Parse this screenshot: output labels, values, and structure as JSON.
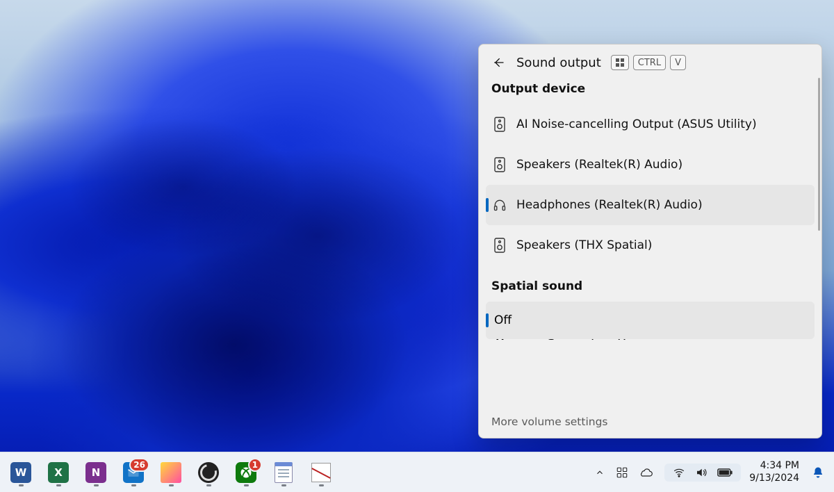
{
  "flyout": {
    "title": "Sound output",
    "shortcut_keys": [
      "WIN",
      "CTRL",
      "V"
    ],
    "section_output": "Output device",
    "devices": [
      {
        "label": "AI Noise-cancelling Output (ASUS Utility)",
        "icon": "speaker",
        "selected": false
      },
      {
        "label": "Speakers (Realtek(R) Audio)",
        "icon": "speaker",
        "selected": false
      },
      {
        "label": "Headphones (Realtek(R) Audio)",
        "icon": "headphones",
        "selected": true
      },
      {
        "label": "Speakers (THX Spatial)",
        "icon": "speaker",
        "selected": false
      }
    ],
    "section_spatial": "Spatial sound",
    "spatial_options": [
      {
        "label": "Off",
        "selected": true
      },
      {
        "label": "Windows Sonic for Headphones",
        "selected": false
      }
    ],
    "more_link": "More volume settings"
  },
  "taskbar": {
    "apps": [
      {
        "name": "word",
        "letter": "W",
        "badge": null
      },
      {
        "name": "excel",
        "letter": "X",
        "badge": null
      },
      {
        "name": "onenote",
        "letter": "N",
        "badge": null
      },
      {
        "name": "outlook",
        "letter": "",
        "badge": "26"
      },
      {
        "name": "sticky-notes",
        "letter": "",
        "badge": null
      },
      {
        "name": "obs",
        "letter": "",
        "badge": null
      },
      {
        "name": "xbox",
        "letter": "",
        "badge": "1"
      },
      {
        "name": "notepad",
        "letter": "",
        "badge": null
      },
      {
        "name": "snipping-tool",
        "letter": "",
        "badge": null
      }
    ],
    "clock": {
      "time": "4:34 PM",
      "date": "9/13/2024"
    }
  }
}
